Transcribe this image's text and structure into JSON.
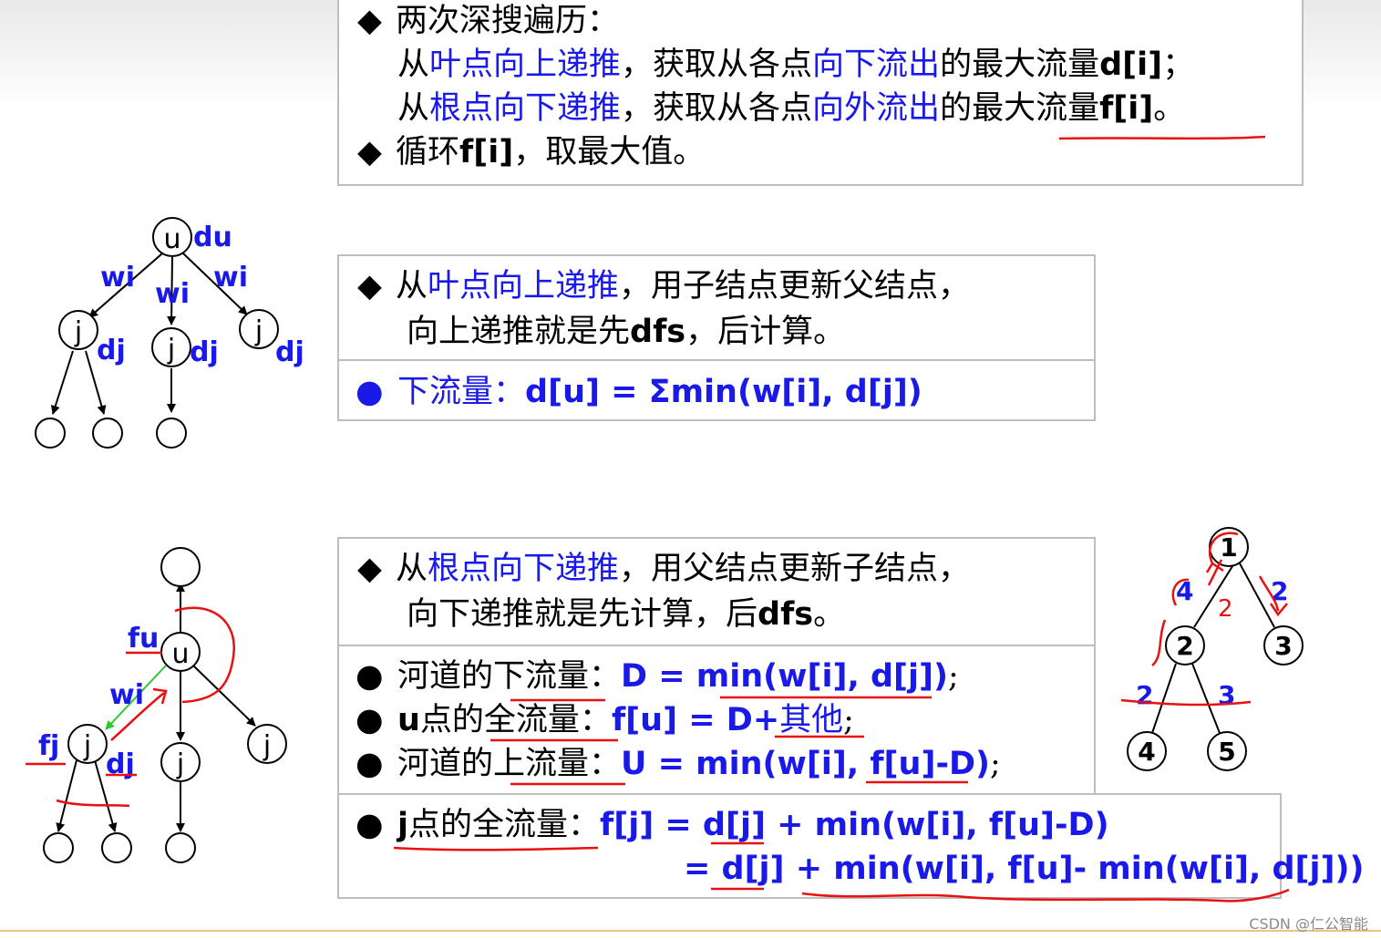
{
  "box1": {
    "line1": {
      "bullet": "◆",
      "text": "两次深搜遍历："
    },
    "line2": {
      "a": "从",
      "b": "叶点向上递推",
      "c": "，获取从各点",
      "d": "向下流出",
      "e": "的最大流量",
      "f": "d[i]",
      "g": "；"
    },
    "line3": {
      "a": "从",
      "b": "根点向下递推",
      "c": "，获取从各点",
      "d": "向外流出",
      "e": "的最大流量",
      "f": "f[i]",
      "g": "。"
    },
    "line4": {
      "bullet": "◆",
      "a": "循环",
      "b": "f[i]",
      "c": "，取最大值。"
    }
  },
  "box2": {
    "line1": {
      "bullet": "◆",
      "a": "从",
      "b": "叶点向上递推",
      "c": "，用子结点更新父结点，"
    },
    "line2": {
      "a": "向上递推就是先",
      "b": "dfs",
      "c": "，后计算。"
    },
    "line3": {
      "bullet": "●",
      "a": "下流量：",
      "b": "d[u] = Σmin(w[i], d[j])"
    }
  },
  "box3": {
    "line1": {
      "bullet": "◆",
      "a": "从",
      "b": "根点向下递推",
      "c": "，用父结点更新子结点，"
    },
    "line2": {
      "a": "向下递推就是先计算，后",
      "b": "dfs",
      "c": "。"
    },
    "line3": {
      "bullet": "●",
      "a": "河道的下流量：",
      "b": "D = min(w[i], d[j])",
      "c": ";"
    },
    "line4": {
      "bullet": "●",
      "a": "u",
      "b": "点的全流量：",
      "c": "f[u] = D+",
      "d": "其他",
      "e": ";"
    },
    "line5": {
      "bullet": "●",
      "a": "河道的上流量：",
      "b": "U = min(w[i], f[u]-D)",
      "c": ";"
    }
  },
  "box4": {
    "line1": {
      "bullet": "●",
      "a": "j",
      "b": "点的全流量：",
      "c": "f[j] = d[j] + min(w[i], f[u]-D)"
    },
    "line2": {
      "a": "= d[j] + min(w[i], f[u]- min(w[i], d[j]))"
    }
  },
  "tree1": {
    "root": "u",
    "root_label": "du",
    "edge_labels": [
      "wi",
      "wi",
      "wi"
    ],
    "child": "j",
    "child_label": "dj"
  },
  "tree2": {
    "u": "u",
    "j": "j",
    "fu": "fu",
    "wi": "wi",
    "fj": "fj",
    "dj": "dj"
  },
  "tree3": {
    "nodes": [
      "1",
      "2",
      "3",
      "4",
      "5"
    ],
    "edge_labels": [
      "4",
      "2",
      "2",
      "3"
    ],
    "arrow_label": "2"
  },
  "watermark": "CSDN @仁公智能",
  "colors": {
    "blue": "#1a1ae8",
    "red": "#e81010",
    "green": "#2ec82e",
    "border": "#bdbdbd"
  }
}
